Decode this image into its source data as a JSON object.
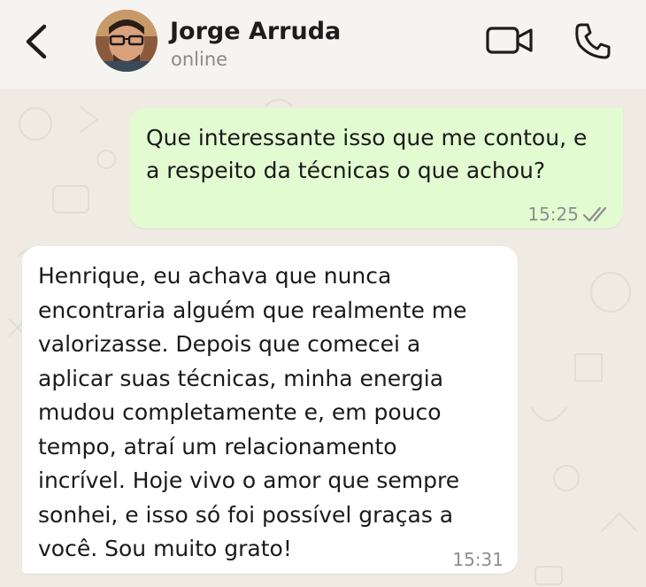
{
  "header": {
    "contact_name": "Jorge Arruda",
    "status": "online",
    "icons": [
      "back-icon",
      "video-call-icon",
      "voice-call-icon"
    ]
  },
  "messages": [
    {
      "direction": "outgoing",
      "text": "Que interessante isso que me contou, e\na respeito da técnicas o que achou?",
      "time": "15:25",
      "status_icon": "double-check-icon"
    },
    {
      "direction": "incoming",
      "text": "Henrique, eu achava que nunca\nencontraria alguém que realmente me\nvalorizasse. Depois que comecei a\naplicar suas técnicas, minha energia\nmudou completamente e, em pouco\ntempo, atraí um relacionamento\nincrível. Hoje vivo o amor que sempre\nsonhei, e isso só foi possível graças a\nvocê. Sou muito grato!",
      "time": "15:31"
    }
  ],
  "colors": {
    "header_bg": "#f5f4f0",
    "chat_bg": "#efeae2",
    "outgoing_bubble": "#e2fbd1",
    "incoming_bubble": "#ffffff",
    "icon_color": "#1d1d1d"
  }
}
